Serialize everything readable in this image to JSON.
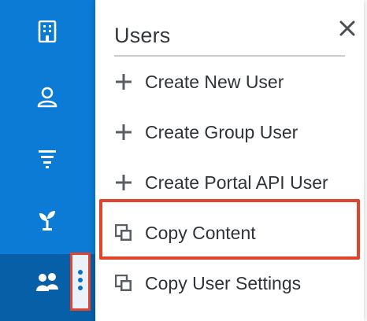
{
  "menu": {
    "title": "Users",
    "items": [
      {
        "label": "Create New User",
        "icon": "plus-icon"
      },
      {
        "label": "Create Group User",
        "icon": "plus-icon"
      },
      {
        "label": "Create Portal API User",
        "icon": "plus-icon"
      },
      {
        "label": "Copy Content",
        "icon": "copy-icon"
      },
      {
        "label": "Copy User Settings",
        "icon": "copy-icon"
      }
    ]
  },
  "sidebar": {
    "icons": [
      "building-icon",
      "user-icon",
      "filter-icon",
      "plant-icon",
      "users-icon"
    ]
  },
  "colors": {
    "sidebar": "#0b7bd6",
    "sidebar_active": "#075fa8",
    "highlight": "#e0452b",
    "text": "#2f3338"
  }
}
